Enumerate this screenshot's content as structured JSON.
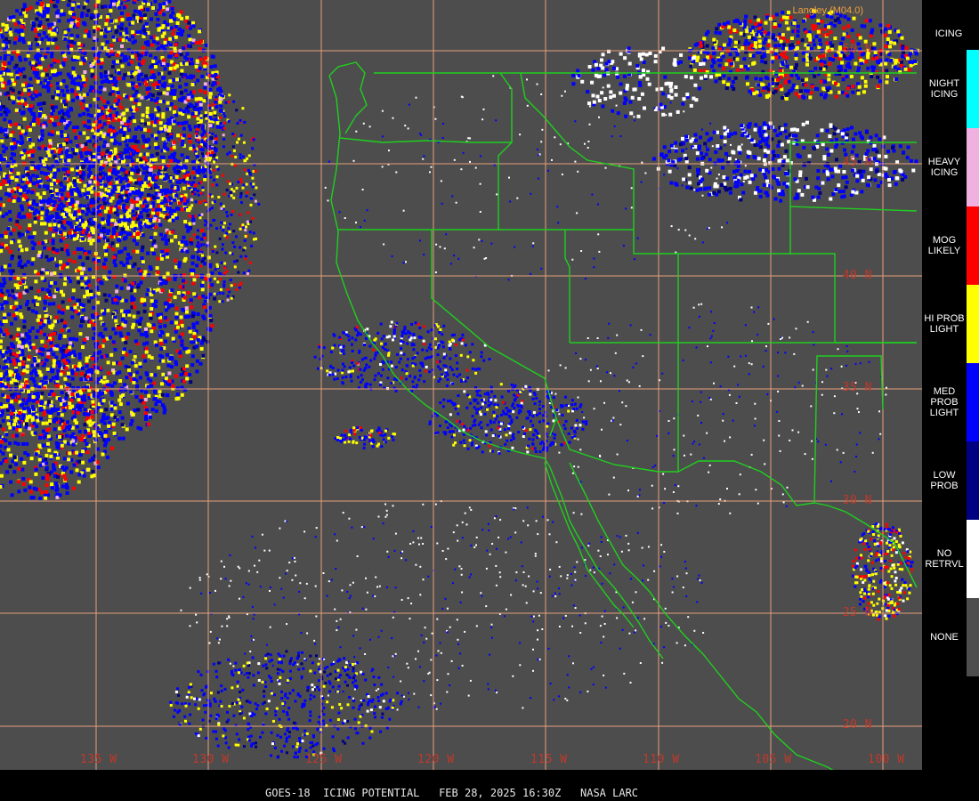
{
  "credit": "Langley (M04.0)",
  "footer": "GOES-18  ICING POTENTIAL   FEB 28, 2025 16:30Z   NASA LARC",
  "legend": {
    "title": "ICING",
    "items": [
      {
        "label": "NIGHT ICING",
        "color": "#00ffff"
      },
      {
        "label": "HEAVY ICING",
        "color": "#f0b0e0"
      },
      {
        "label": "MOG LIKELY",
        "color": "#ff0000"
      },
      {
        "label": "HI PROB LIGHT",
        "color": "#ffff00"
      },
      {
        "label": "MED PROB LIGHT",
        "color": "#0000ff"
      },
      {
        "label": "LOW PROB",
        "color": "#000080"
      },
      {
        "label": "NO RETRVL",
        "color": "#ffffff"
      },
      {
        "label": "NONE",
        "color": "#4d4d4d"
      }
    ]
  },
  "lat_labels": [
    "50 N",
    "45 N",
    "40 N",
    "35 N",
    "30 N",
    "25 N",
    "20 N"
  ],
  "lon_labels": [
    "135 W",
    "130 W",
    "125 W",
    "120 W",
    "115 W",
    "110 W",
    "105 W",
    "100 W"
  ],
  "colors": {
    "background": "#4d4d4d",
    "gridline": "#e8a07a",
    "coastline": "#00ff00",
    "label": "#c0392b"
  }
}
